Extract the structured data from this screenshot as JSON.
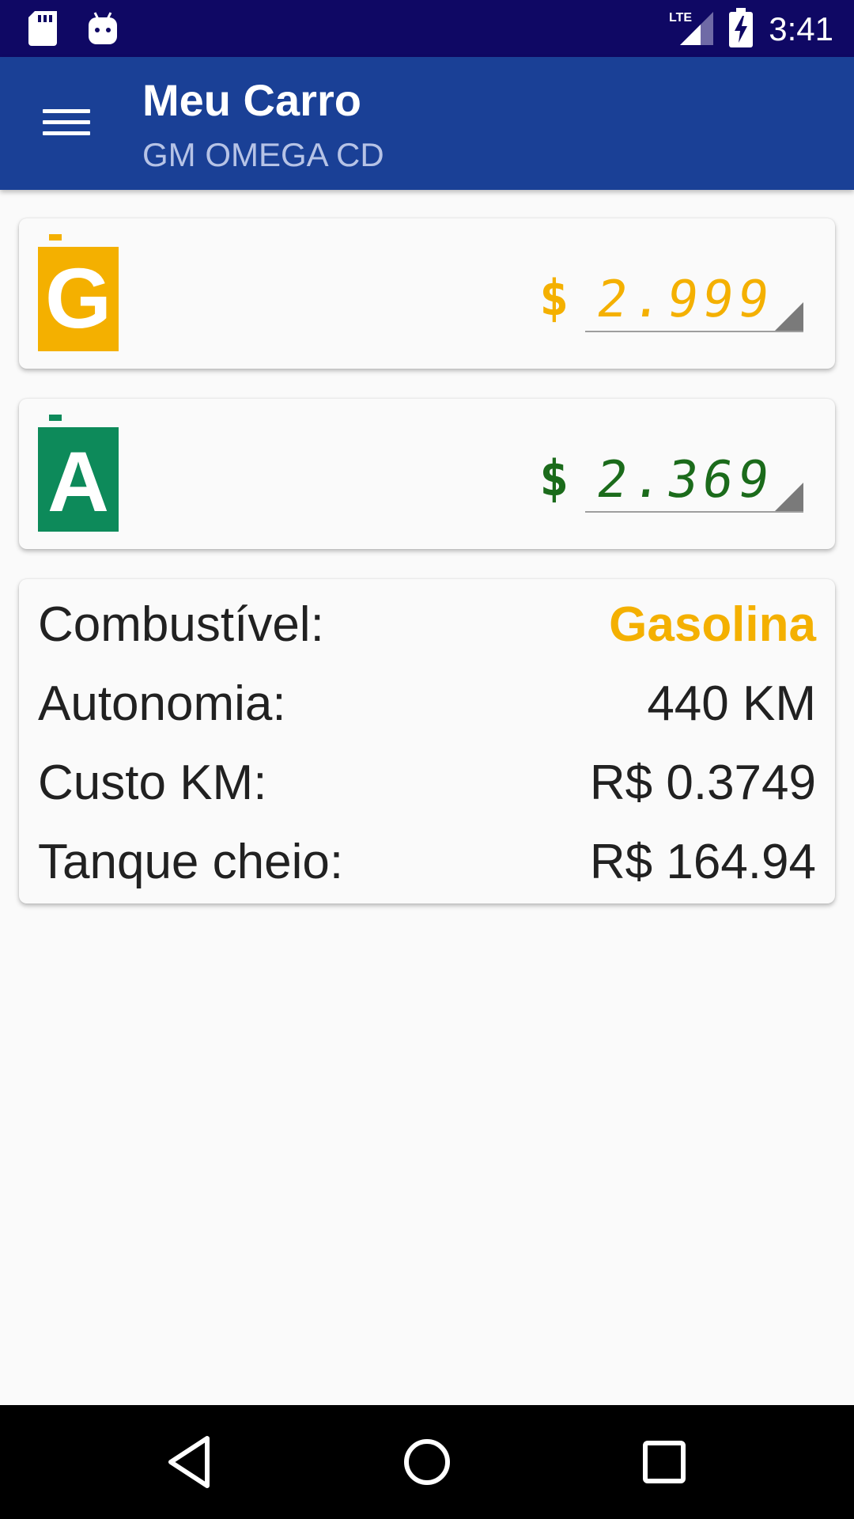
{
  "status_bar": {
    "time": "3:41",
    "network": "LTE",
    "icons": [
      "sd-card-icon",
      "android-icon",
      "signal-icon",
      "battery-charging-icon"
    ]
  },
  "app_bar": {
    "title": "Meu Carro",
    "subtitle": "GM OMEGA CD",
    "menu_icon": "hamburger-menu-icon"
  },
  "fuels": [
    {
      "letter": "G",
      "icon": "gasoline-can-icon",
      "color": "#f4b000",
      "currency": "$",
      "price": "2.999"
    },
    {
      "letter": "A",
      "icon": "alcohol-can-icon",
      "color": "#0d8a5a",
      "price_color": "#1b6b1b",
      "currency": "$",
      "price": "2.369"
    }
  ],
  "info": {
    "rows": [
      {
        "label": "Combustível:",
        "value": "Gasolina"
      },
      {
        "label": "Autonomia:",
        "value": "440 KM"
      },
      {
        "label": "Custo KM:",
        "value": "R$ 0.3749"
      },
      {
        "label": "Tanque cheio:",
        "value": "R$ 164.94"
      }
    ],
    "highlight_color": "#f4b000"
  },
  "nav_bar": {
    "buttons": [
      "back-icon",
      "home-icon",
      "recents-icon"
    ]
  },
  "colors": {
    "status_bar": "#0f0864",
    "app_bar": "#1a4096",
    "background": "#fafafa"
  }
}
